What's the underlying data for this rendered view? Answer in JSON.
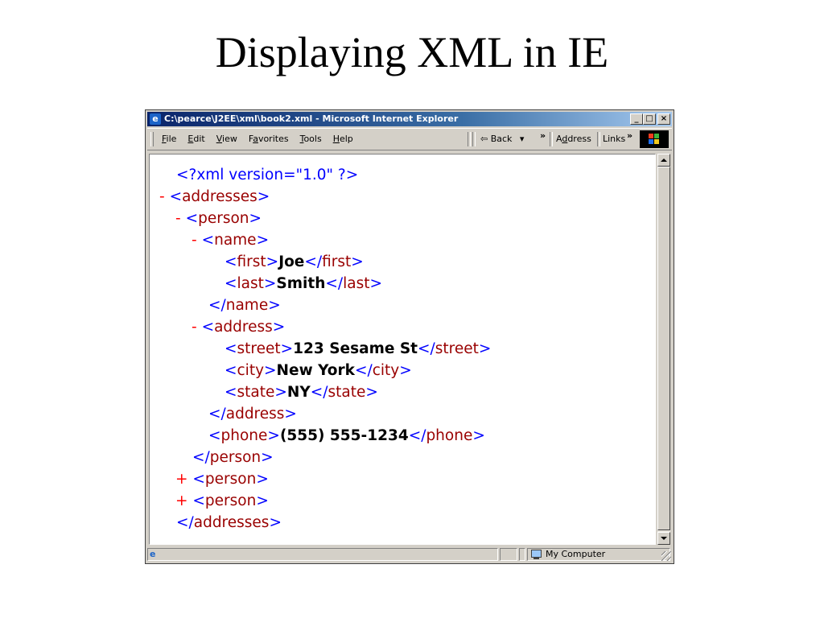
{
  "slide": {
    "title": "Displaying XML in IE"
  },
  "window": {
    "title": "C:\\pearce\\J2EE\\xml\\book2.xml - Microsoft Internet Explorer",
    "app_icon": "ie-icon",
    "controls": {
      "minimize": "_",
      "maximize": "□",
      "close": "×"
    }
  },
  "menubar": {
    "items": [
      {
        "label": "File",
        "underline": "F"
      },
      {
        "label": "Edit",
        "underline": "E"
      },
      {
        "label": "View",
        "underline": "V"
      },
      {
        "label": "Favorites",
        "underline": "a"
      },
      {
        "label": "Tools",
        "underline": "T"
      },
      {
        "label": "Help",
        "underline": "H"
      }
    ],
    "back_label": "⇦ Back",
    "dropdown_glyph": "▾",
    "chevron": "»",
    "address_label": "Address",
    "links_label": "Links",
    "links_chevron": "»"
  },
  "xml": {
    "declaration": "<?xml version=\"1.0\" ?>",
    "toggle_minus": "-",
    "toggle_plus": "+",
    "addresses_tag": "addresses",
    "person_tag": "person",
    "name_tag": "name",
    "first_tag": "first",
    "first_value": "Joe",
    "last_tag": "last",
    "last_value": "Smith",
    "address_tag": "address",
    "street_tag": "street",
    "street_value": "123 Sesame St",
    "city_tag": "city",
    "city_value": "New York",
    "state_tag": "state",
    "state_value": "NY",
    "phone_tag": "phone",
    "phone_value": "(555) 555-1234"
  },
  "statusbar": {
    "zone_label": "My Computer",
    "page_icon": "ie-page-icon"
  },
  "colors": {
    "title_gradient_start": "#0a246a",
    "title_gradient_end": "#a6caf0",
    "tag_name": "#990000",
    "markup": "#0000ff",
    "toggle": "#ff0000",
    "chrome": "#d4d0c8"
  }
}
